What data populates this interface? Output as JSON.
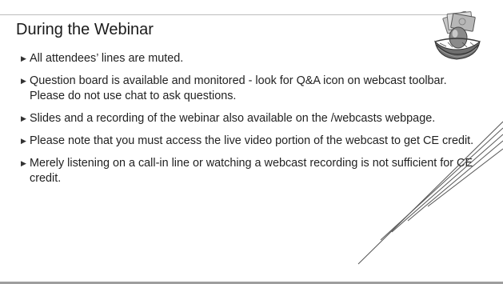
{
  "slide": {
    "title": "During the Webinar",
    "bullets": [
      {
        "text": "All attendees’ lines are muted."
      },
      {
        "text": "Question board is available and monitored - look for Q&A icon on webcast toolbar. Please do not use chat to ask questions."
      },
      {
        "text": "Slides and a recording of the webinar also available on the /webcasts webpage."
      },
      {
        "text": "Please note that you must access the live video portion of the webcast to get CE credit."
      },
      {
        "text": "Merely listening on a call-in line  or watching a webcast recording is not sufficient for CE credit."
      }
    ],
    "bullet_marker": "▶",
    "icons": {
      "logo": "nest-egg-money-icon"
    },
    "colors": {
      "title": "#1a1a1a",
      "text": "#222222",
      "accent_lines": "#555555"
    }
  }
}
